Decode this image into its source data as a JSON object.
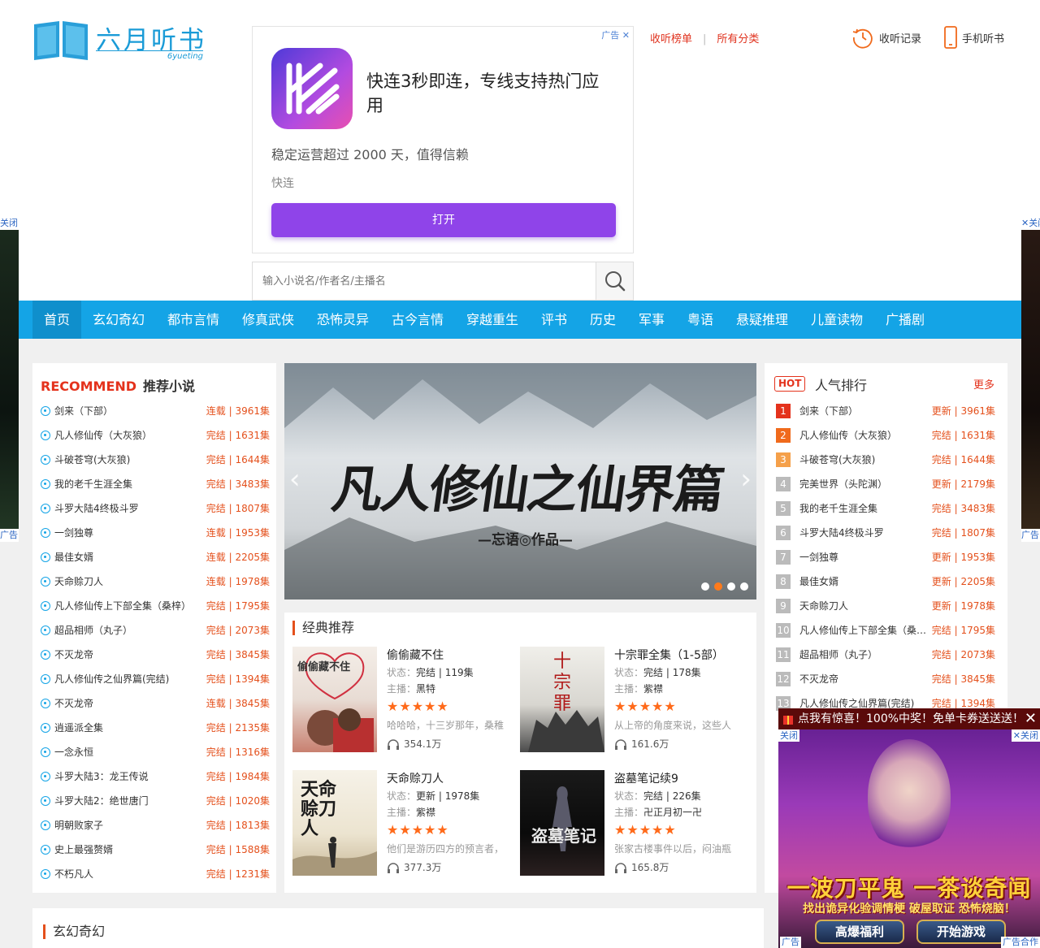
{
  "logo": {
    "text": "六月听书",
    "sub": "6yueting"
  },
  "ad_top": {
    "tag": "广告",
    "headline": "快连3秒即连，专线支持热门应用",
    "desc": "稳定运营超过 2000 天，值得信赖",
    "app_name": "快连",
    "button": "打开"
  },
  "search": {
    "placeholder": "输入小说名/作者名/主播名"
  },
  "top_links": {
    "ranking": "收听榜单",
    "categories": "所有分类",
    "history": "收听记录",
    "mobile": "手机听书"
  },
  "nav": [
    "首页",
    "玄幻奇幻",
    "都市言情",
    "修真武侠",
    "恐怖灵异",
    "古今言情",
    "穿越重生",
    "评书",
    "历史",
    "军事",
    "粤语",
    "悬疑推理",
    "儿童读物",
    "广播剧"
  ],
  "side_ads": {
    "close": "关闭",
    "ad": "广告"
  },
  "recommend": {
    "title_en": "RECOMMEND",
    "title": "推荐小说",
    "items": [
      {
        "name": "剑来（下部）",
        "status": "连载 | 3961集"
      },
      {
        "name": "凡人修仙传（大灰狼）",
        "status": "完结 | 1631集"
      },
      {
        "name": "斗破苍穹(大灰狼)",
        "status": "完结 | 1644集"
      },
      {
        "name": "我的老千生涯全集",
        "status": "完结 | 3483集"
      },
      {
        "name": "斗罗大陆4终极斗罗",
        "status": "完结 | 1807集"
      },
      {
        "name": "一剑独尊",
        "status": "连载 | 1953集"
      },
      {
        "name": "最佳女婿",
        "status": "连载 | 2205集"
      },
      {
        "name": "天命赊刀人",
        "status": "连载 | 1978集"
      },
      {
        "name": "凡人修仙传上下部全集（桑梓）",
        "status": "完结 | 1795集"
      },
      {
        "name": "超品相师（丸子）",
        "status": "完结 | 2073集"
      },
      {
        "name": "不灭龙帝",
        "status": "完结 | 3845集"
      },
      {
        "name": "凡人修仙传之仙界篇(完结)",
        "status": "完结 | 1394集"
      },
      {
        "name": "不灭龙帝",
        "status": "连载 | 3845集"
      },
      {
        "name": "逍遥派全集",
        "status": "完结 | 2135集"
      },
      {
        "name": "一念永恒",
        "status": "完结 | 1316集"
      },
      {
        "name": "斗罗大陆3：龙王传说",
        "status": "完结 | 1984集"
      },
      {
        "name": "斗罗大陆2：绝世唐门",
        "status": "完结 | 1020集"
      },
      {
        "name": "明朝败家子",
        "status": "完结 | 1813集"
      },
      {
        "name": "史上最强赘婿",
        "status": "完结 | 1588集"
      },
      {
        "name": "不朽凡人",
        "status": "完结 | 1231集"
      }
    ]
  },
  "banner": {
    "title": "凡人修仙之仙界篇",
    "author": "—忘语◎作品—"
  },
  "classic": {
    "title": "经典推荐",
    "status_label": "状态：",
    "host_label": "主播：",
    "stars": "★★★★★",
    "cards": [
      {
        "title": "偷偷藏不住",
        "status": "完结 | 119集",
        "host": "黑特",
        "desc": "哈哈哈，十三岁那年，桑稚",
        "plays": "354.1万",
        "cover_text": "偷偷藏不住"
      },
      {
        "title": "十宗罪全集（1-5部）",
        "status": "完结 | 178集",
        "host": "紫襟",
        "desc": "从上帝的角度来说，这些人",
        "plays": "161.6万",
        "cover_text": "十宗罪"
      },
      {
        "title": "天命赊刀人",
        "status": "更新 | 1978集",
        "host": "紫襟",
        "desc": "他们是游历四方的预言者，",
        "plays": "377.3万",
        "cover_text": "天命赊刀人"
      },
      {
        "title": "盗墓笔记续9",
        "status": "完结 | 226集",
        "host": "卍正月初一卍",
        "desc": "张家古楼事件以后，闷油瓶",
        "plays": "165.8万",
        "cover_text": "盗墓笔记"
      }
    ]
  },
  "hot": {
    "badge": "HOT",
    "title": "人气排行",
    "more": "更多",
    "items": [
      {
        "rank": "1",
        "name": "剑来（下部）",
        "status": "更新 | 3961集",
        "color": "#e4321c"
      },
      {
        "rank": "2",
        "name": "凡人修仙传（大灰狼）",
        "status": "完结 | 1631集",
        "color": "#f06a1c"
      },
      {
        "rank": "3",
        "name": "斗破苍穹(大灰狼)",
        "status": "完结 | 1644集",
        "color": "#f5a04a"
      },
      {
        "rank": "4",
        "name": "完美世界（头陀渊）",
        "status": "更新 | 2179集",
        "color": "#bbbbbb"
      },
      {
        "rank": "5",
        "name": "我的老千生涯全集",
        "status": "完结 | 3483集",
        "color": "#bbbbbb"
      },
      {
        "rank": "6",
        "name": "斗罗大陆4终极斗罗",
        "status": "完结 | 1807集",
        "color": "#bbbbbb"
      },
      {
        "rank": "7",
        "name": "一剑独尊",
        "status": "更新 | 1953集",
        "color": "#bbbbbb"
      },
      {
        "rank": "8",
        "name": "最佳女婿",
        "status": "更新 | 2205集",
        "color": "#bbbbbb"
      },
      {
        "rank": "9",
        "name": "天命赊刀人",
        "status": "更新 | 1978集",
        "color": "#bbbbbb"
      },
      {
        "rank": "10",
        "name": "凡人修仙传上下部全集（桑…",
        "status": "完结 | 1795集",
        "color": "#bbbbbb"
      },
      {
        "rank": "11",
        "name": "超品相师（丸子）",
        "status": "完结 | 2073集",
        "color": "#bbbbbb"
      },
      {
        "rank": "12",
        "name": "不灭龙帝",
        "status": "完结 | 3845集",
        "color": "#bbbbbb"
      },
      {
        "rank": "13",
        "name": "凡人修仙传之仙界篇(完结)",
        "status": "完结 | 1394集",
        "color": "#bbbbbb"
      }
    ]
  },
  "bottom_section": {
    "title": "玄幻奇幻"
  },
  "popup_ad": {
    "bar": "点我有惊喜！100%中奖！免单卡券送送送！",
    "close_left": "关闭",
    "close_right": "关闭",
    "headline": "一波刀平鬼 一茶谈奇闻",
    "sub": "找出诡异化验调情梗 破屋取证 恐怖烧脑！",
    "btn1": "高爆福利",
    "btn2": "开始游戏",
    "ad_left": "广告",
    "ad_right": "广告合作"
  }
}
